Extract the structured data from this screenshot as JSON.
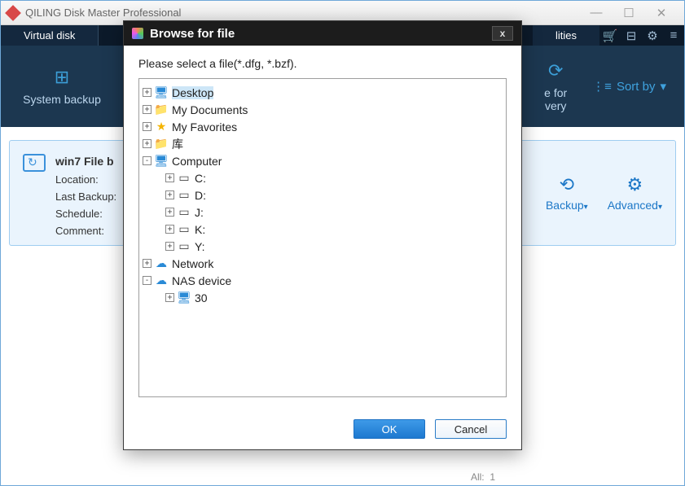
{
  "app": {
    "title": "QILING Disk Master Professional"
  },
  "winbtns": {
    "min": "—",
    "max": "☐",
    "close": "✕"
  },
  "ribbon": {
    "tab1": "Virtual disk",
    "tab2": "lities",
    "icons": {
      "cart": "🛒",
      "list": "⊟",
      "gear": "⚙",
      "menu": "≡"
    }
  },
  "toolbar": {
    "item1": {
      "icon": "⊞",
      "label": "System backup"
    },
    "item2": {
      "icon": "⟳",
      "label_line1": "e for",
      "label_line2": "very"
    },
    "sort": {
      "icon": "⋮≡",
      "label": "Sort by",
      "caret": "▾"
    }
  },
  "card": {
    "title": "win7 File b",
    "rows": {
      "loc": "Location:",
      "last": "Last Backup:",
      "sched": "Schedule:",
      "comment": "Comment:"
    },
    "actions": {
      "backup": {
        "icon": "⟲",
        "label": "Backup",
        "caret": "▾"
      },
      "advanced": {
        "icon": "⚙",
        "label": "Advanced",
        "caret": "▾"
      }
    }
  },
  "status": {
    "all": "All:",
    "count": "1"
  },
  "dialog": {
    "title": "Browse for file",
    "prompt": "Please select a file(*.dfg, *.bzf).",
    "ok": "OK",
    "cancel": "Cancel",
    "close": "x",
    "tree": {
      "desktop": "Desktop",
      "mydocs": "My Documents",
      "myfav": "My Favorites",
      "lib": "库",
      "computer": "Computer",
      "drives": {
        "c": "C:",
        "d": "D:",
        "j": "J:",
        "k": "K:",
        "y": "Y:"
      },
      "network": "Network",
      "nas": "NAS device",
      "nas_child": "30"
    }
  }
}
